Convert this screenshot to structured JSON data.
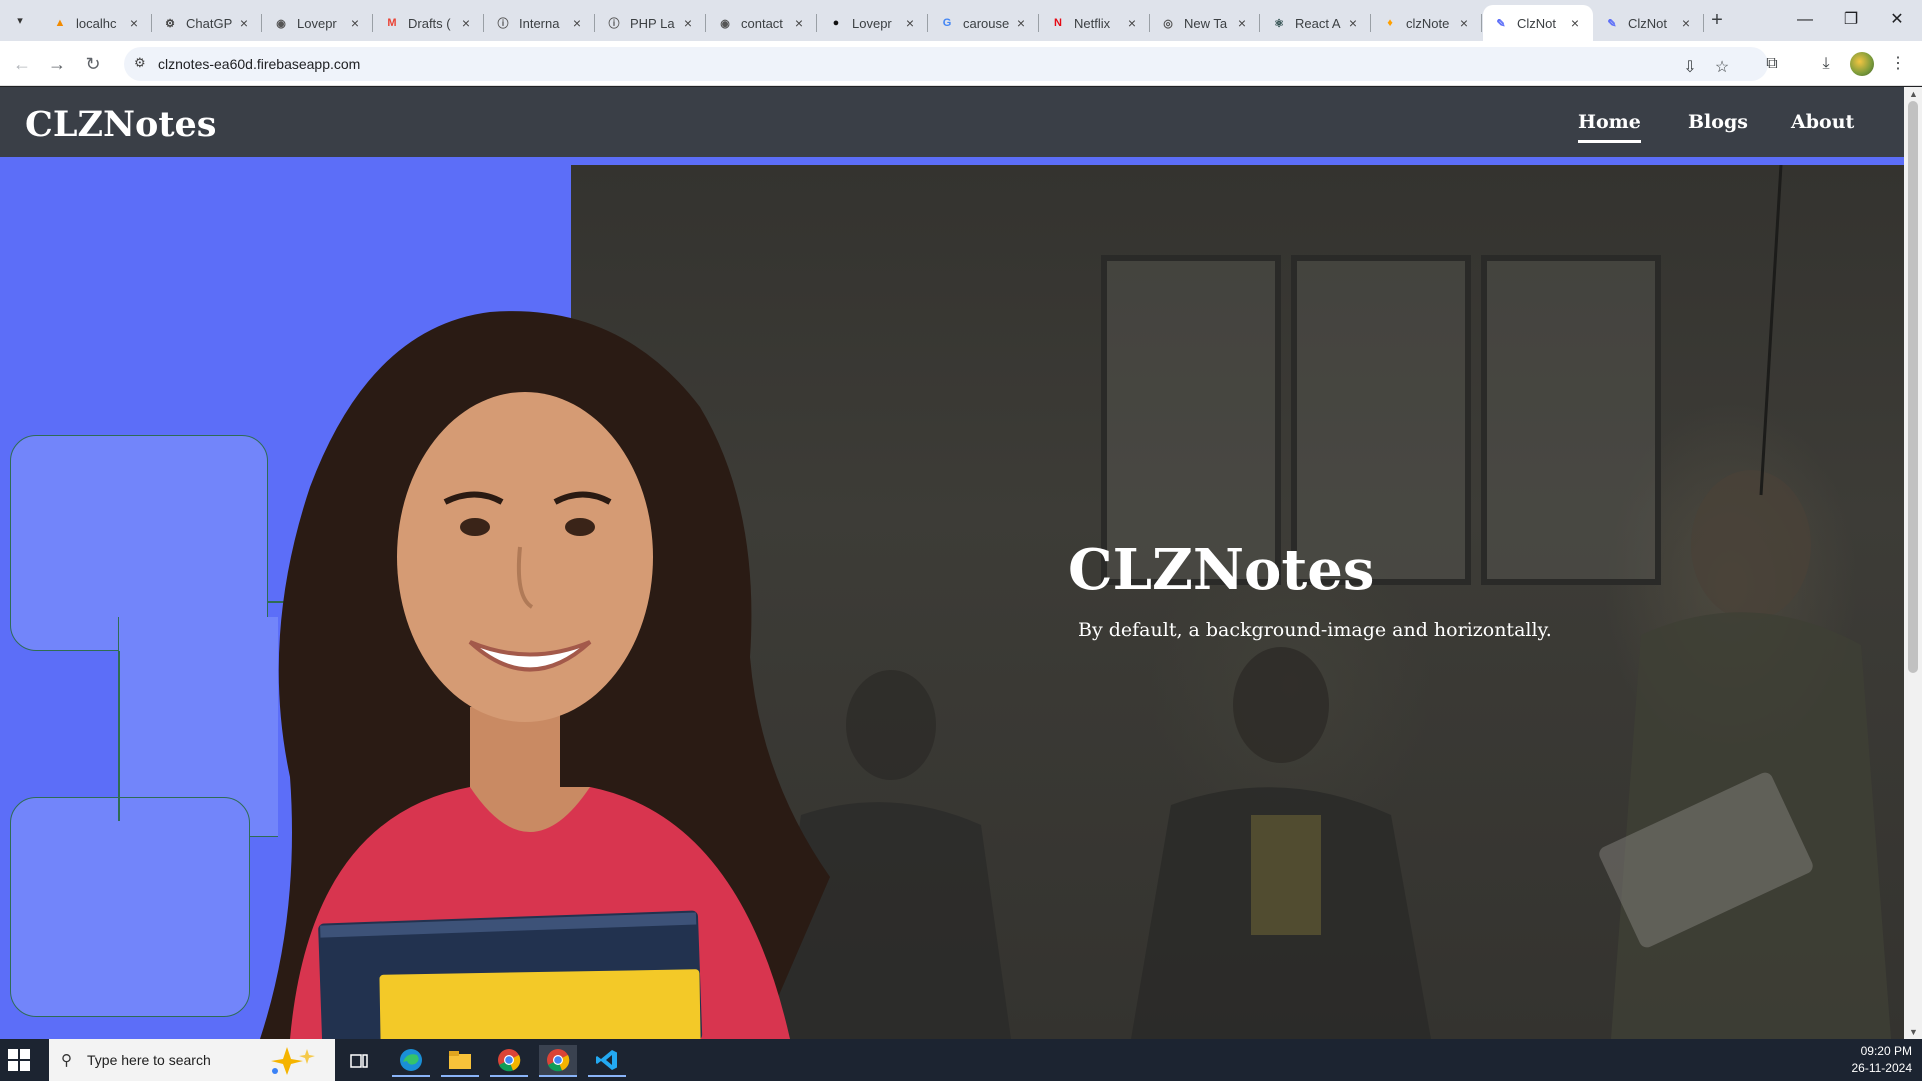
{
  "browser": {
    "tabs": [
      {
        "title": "localhc",
        "favicon": "xampp-icon",
        "fav_color": "#f28b00",
        "fav_char": "▲"
      },
      {
        "title": "ChatGP",
        "favicon": "chatgpt-icon",
        "fav_color": "#444444",
        "fav_char": "⚙"
      },
      {
        "title": "Lovepr",
        "favicon": "globe-icon",
        "fav_color": "#555555",
        "fav_char": "◉"
      },
      {
        "title": "Drafts (",
        "favicon": "gmail-icon",
        "fav_color": "#ea4335",
        "fav_char": "M"
      },
      {
        "title": "Interna",
        "favicon": "info-icon",
        "fav_color": "#555555",
        "fav_char": "ⓘ"
      },
      {
        "title": "PHP La",
        "favicon": "info-icon",
        "fav_color": "#555555",
        "fav_char": "ⓘ"
      },
      {
        "title": "contact",
        "favicon": "globe-icon",
        "fav_color": "#555555",
        "fav_char": "◉"
      },
      {
        "title": "Lovepr",
        "favicon": "github-icon",
        "fav_color": "#111111",
        "fav_char": "●"
      },
      {
        "title": "carouse",
        "favicon": "google-icon",
        "fav_color": "#4285f4",
        "fav_char": "G"
      },
      {
        "title": "Netflix",
        "favicon": "netflix-icon",
        "fav_color": "#e50914",
        "fav_char": "N"
      },
      {
        "title": "New Ta",
        "favicon": "chrome-icon",
        "fav_color": "#555555",
        "fav_char": "◎"
      },
      {
        "title": "React A",
        "favicon": "react-icon",
        "fav_color": "#2b4a4a",
        "fav_char": "⚛"
      },
      {
        "title": "clzNote",
        "favicon": "firebase-icon",
        "fav_color": "#ffa000",
        "fav_char": "♦"
      },
      {
        "title": "ClzNot",
        "favicon": "quill-icon",
        "fav_color": "#5c6ef8",
        "fav_char": "✎",
        "active": true
      },
      {
        "title": "ClzNot",
        "favicon": "quill-icon",
        "fav_color": "#5c6ef8",
        "fav_char": "✎"
      }
    ],
    "url": "clznotes-ea60d.firebaseapp.com"
  },
  "site": {
    "brand": "CLZNotes",
    "nav": {
      "home": "Home",
      "blogs": "Blogs",
      "about": "About"
    },
    "hero": {
      "title": "CLZNotes",
      "subtitle": "By default, a background-image and horizontally."
    },
    "colors": {
      "accent": "#5c6ef8",
      "navbar": "#3a3f47",
      "deco_border": "#2f6c54"
    }
  },
  "taskbar": {
    "search_placeholder": "Type here to search",
    "time": "09:20 PM",
    "date": "26-11-2024",
    "apps": [
      "task-view-icon",
      "edge-icon",
      "file-explorer-icon",
      "chrome-icon",
      "chrome-profile-icon",
      "vscode-icon"
    ]
  }
}
